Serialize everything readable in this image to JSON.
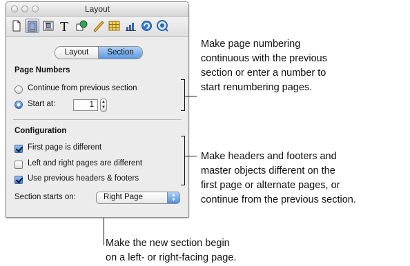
{
  "window": {
    "title": "Layout",
    "toolbar_icons": [
      "document-icon",
      "layout-icon",
      "wrap-icon",
      "text-icon",
      "graphic-icon",
      "metrics-icon",
      "table-icon",
      "chart-icon",
      "link-icon",
      "quicktime-icon"
    ],
    "tabs": [
      {
        "label": "Layout",
        "selected": false
      },
      {
        "label": "Section",
        "selected": true
      }
    ],
    "page_numbers": {
      "heading": "Page Numbers",
      "continue_label": "Continue from previous section",
      "continue_selected": false,
      "start_at_label": "Start at:",
      "start_at_selected": true,
      "start_at_value": "1"
    },
    "configuration": {
      "heading": "Configuration",
      "first_page_label": "First page is different",
      "first_page_checked": true,
      "left_right_label": "Left and right pages are different",
      "left_right_checked": false,
      "use_previous_label": "Use previous headers & footers",
      "use_previous_checked": true,
      "section_starts_label": "Section starts on:",
      "section_starts_value": "Right Page"
    }
  },
  "callouts": {
    "page_numbering": [
      "Make page numbering",
      "continuous with the previous",
      "section or enter a number to",
      "start renumbering pages."
    ],
    "headers_footers": [
      "Make headers and footers and",
      "master objects different on the",
      "first page or alternate pages, or",
      "continue from the previous section."
    ],
    "section_begin": [
      "Make the new section begin",
      "on a left- or right-facing page."
    ]
  },
  "colors": {
    "selected_blue": "#5d9ae2",
    "panel_bg": "#ececec"
  }
}
